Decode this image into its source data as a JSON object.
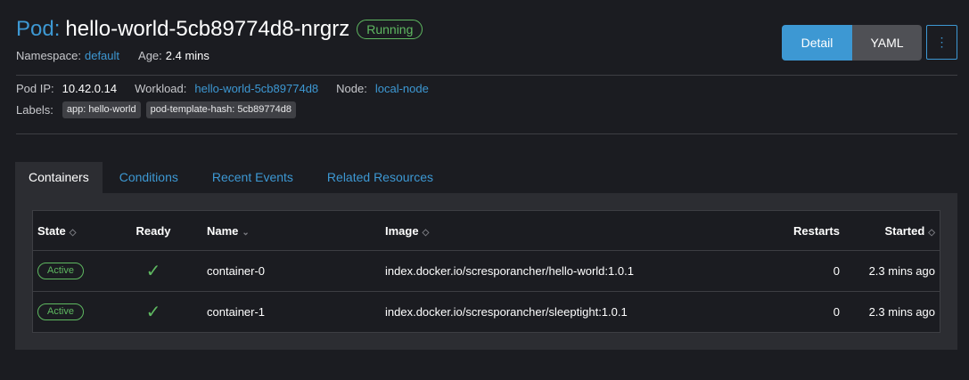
{
  "header": {
    "resource_type": "Pod:",
    "name": "hello-world-5cb89774d8-nrgrz",
    "status": "Running",
    "namespace_label": "Namespace:",
    "namespace_value": "default",
    "age_label": "Age:",
    "age_value": "2.4 mins",
    "buttons": {
      "detail": "Detail",
      "yaml": "YAML",
      "more": "⋮"
    }
  },
  "info": {
    "pod_ip_label": "Pod IP:",
    "pod_ip_value": "10.42.0.14",
    "workload_label": "Workload:",
    "workload_value": "hello-world-5cb89774d8",
    "node_label": "Node:",
    "node_value": "local-node",
    "labels_label": "Labels:",
    "labels": [
      "app: hello-world",
      "pod-template-hash: 5cb89774d8"
    ]
  },
  "tabs": [
    {
      "label": "Containers",
      "active": true
    },
    {
      "label": "Conditions",
      "active": false
    },
    {
      "label": "Recent Events",
      "active": false
    },
    {
      "label": "Related Resources",
      "active": false
    }
  ],
  "table": {
    "columns": {
      "state": "State",
      "ready": "Ready",
      "name": "Name",
      "image": "Image",
      "restarts": "Restarts",
      "started": "Started"
    },
    "rows": [
      {
        "state": "Active",
        "ready_icon": "check-icon",
        "name": "container-0",
        "image": "index.docker.io/scresporancher/hello-world:1.0.1",
        "restarts": "0",
        "started": "2.3 mins ago"
      },
      {
        "state": "Active",
        "ready_icon": "check-icon",
        "name": "container-1",
        "image": "index.docker.io/scresporancher/sleeptight:1.0.1",
        "restarts": "0",
        "started": "2.3 mins ago"
      }
    ]
  },
  "colors": {
    "background": "#1b1c21",
    "accent": "#3d98d3",
    "success": "#5fb961",
    "panel": "#2c2d32"
  }
}
